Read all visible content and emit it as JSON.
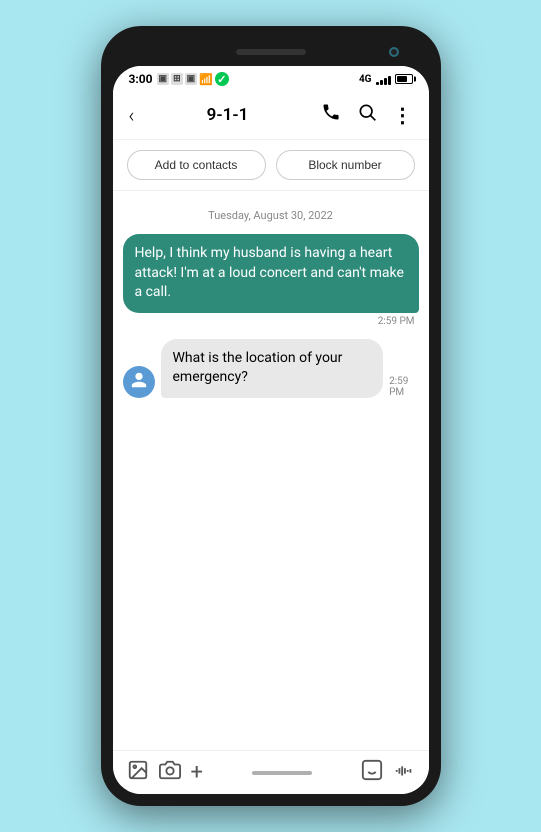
{
  "statusBar": {
    "time": "3:00",
    "leftIcons": [
      "🔲",
      "📷",
      "🖼",
      "📶",
      "🟢"
    ],
    "signal": "4G",
    "batteryLevel": 75
  },
  "navBar": {
    "backLabel": "‹",
    "title": "9-1-1",
    "callIcon": "📞",
    "searchIcon": "🔍",
    "moreIcon": "⋮"
  },
  "actionButtons": {
    "addToContacts": "Add to contacts",
    "blockNumber": "Block number"
  },
  "chat": {
    "dateDivider": "Tuesday, August 30, 2022",
    "messages": [
      {
        "type": "outgoing",
        "text": "Help, I think my husband is having a heart attack! I'm at a loud concert and can't make a call.",
        "time": "2:59 PM"
      },
      {
        "type": "incoming",
        "text": "What is the location of your emergency?",
        "time": "2:59 PM"
      }
    ]
  },
  "bottomToolbar": {
    "imageIcon": "🖼",
    "cameraIcon": "📷",
    "addIcon": "+",
    "voiceIcon": "🎙"
  }
}
